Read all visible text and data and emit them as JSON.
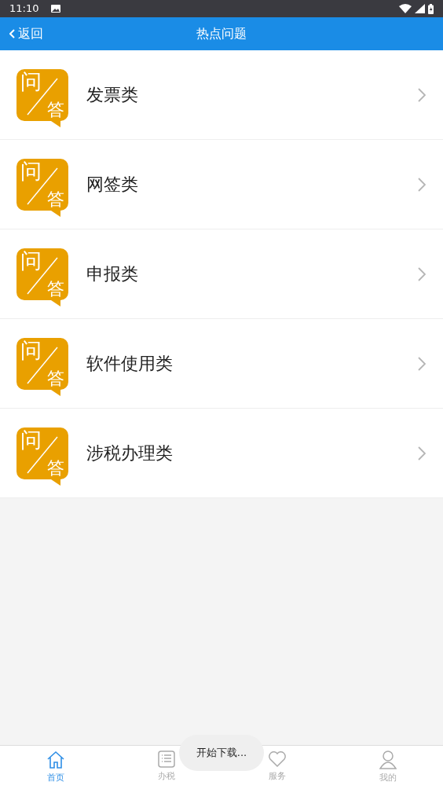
{
  "status_bar": {
    "time": "11:10"
  },
  "header": {
    "back": "返回",
    "title": "热点问题"
  },
  "items": [
    {
      "logo_top": "问",
      "logo_bottom": "答",
      "label": "发票类"
    },
    {
      "logo_top": "问",
      "logo_bottom": "答",
      "label": "网签类"
    },
    {
      "logo_top": "问",
      "logo_bottom": "答",
      "label": "申报类"
    },
    {
      "logo_top": "问",
      "logo_bottom": "答",
      "label": "软件使用类"
    },
    {
      "logo_top": "问",
      "logo_bottom": "答",
      "label": "涉税办理类"
    }
  ],
  "toast": "开始下载...",
  "nav": [
    {
      "kind": "home",
      "label": "首页",
      "selected": true
    },
    {
      "kind": "list",
      "label": "办税",
      "selected": false
    },
    {
      "kind": "heart",
      "label": "服务",
      "selected": false
    },
    {
      "kind": "person",
      "label": "我的",
      "selected": false
    }
  ]
}
